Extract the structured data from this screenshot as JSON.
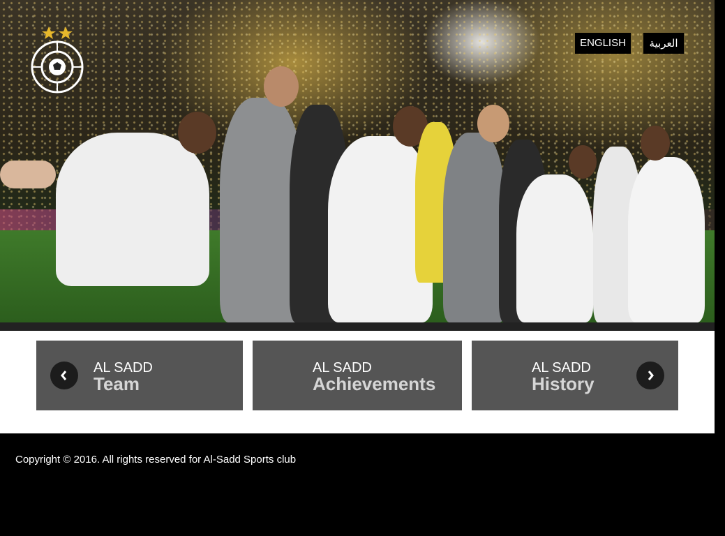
{
  "header": {
    "logo_alt": "Al Sadd Sports Club",
    "lang_english": "ENGLISH",
    "lang_arabic": "العربية"
  },
  "cards": [
    {
      "small": "AL SADD",
      "big": "Team"
    },
    {
      "small": "AL SADD",
      "big": "Achievements"
    },
    {
      "small": "AL SADD",
      "big": "History"
    }
  ],
  "footer": {
    "copyright": "Copyright © 2016. All rights reserved for Al-Sadd Sports club"
  },
  "icons": {
    "prev": "chevron-left-icon",
    "next": "chevron-right-icon"
  }
}
